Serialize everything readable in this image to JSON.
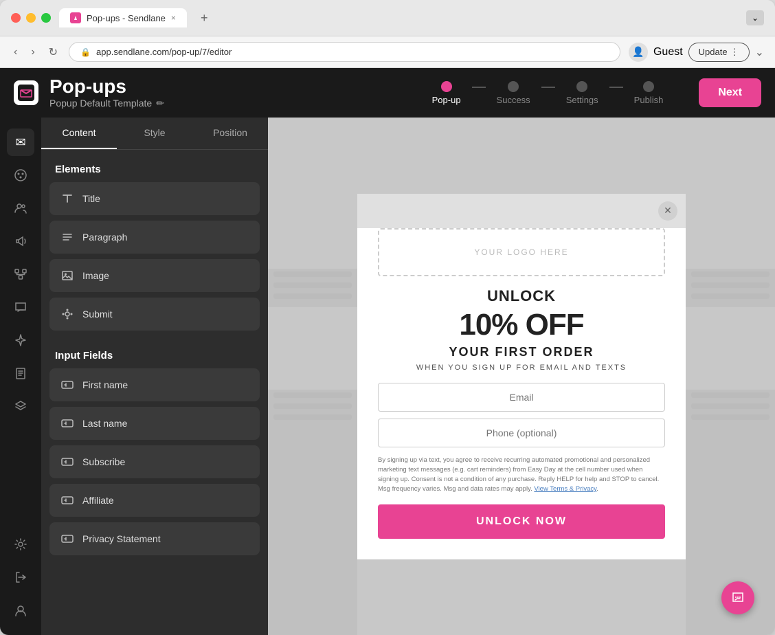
{
  "browser": {
    "tab_title": "Pop-ups - Sendlane",
    "tab_close": "×",
    "new_tab": "+",
    "address": "app.sendlane.com/pop-up/7/editor",
    "account_label": "Guest",
    "update_label": "Update",
    "expand_label": "⌄"
  },
  "header": {
    "title": "Pop-ups",
    "subtitle": "Popup Default Template",
    "edit_icon": "✏",
    "next_label": "Next"
  },
  "wizard": {
    "steps": [
      {
        "label": "Pop-up",
        "active": true
      },
      {
        "label": "Success",
        "active": false
      },
      {
        "label": "Settings",
        "active": false
      },
      {
        "label": "Publish",
        "active": false
      }
    ]
  },
  "sidebar_tabs": [
    "Content",
    "Style",
    "Position"
  ],
  "active_sidebar_tab": "Content",
  "elements_section": "Elements",
  "elements": [
    {
      "icon": "T",
      "label": "Title"
    },
    {
      "icon": "≡",
      "label": "Paragraph"
    },
    {
      "icon": "🖼",
      "label": "Image"
    },
    {
      "icon": "✦",
      "label": "Submit"
    }
  ],
  "input_fields_section": "Input Fields",
  "input_fields": [
    {
      "icon": "⊞",
      "label": "First name"
    },
    {
      "icon": "⊞",
      "label": "Last name"
    },
    {
      "icon": "⊞",
      "label": "Subscribe"
    },
    {
      "icon": "⊞",
      "label": "Affiliate"
    },
    {
      "icon": "⊞",
      "label": "Privacy Statement"
    }
  ],
  "nav_icons": [
    {
      "name": "mail-icon",
      "symbol": "✉",
      "active": true
    },
    {
      "name": "palette-icon",
      "symbol": "🎨",
      "active": false
    },
    {
      "name": "contacts-icon",
      "symbol": "👥",
      "active": false
    },
    {
      "name": "megaphone-icon",
      "symbol": "📣",
      "active": false
    },
    {
      "name": "workflow-icon",
      "symbol": "⚙",
      "active": false
    },
    {
      "name": "chat-icon",
      "symbol": "💬",
      "active": false
    },
    {
      "name": "sparkle-icon",
      "symbol": "✨",
      "active": false
    },
    {
      "name": "pages-icon",
      "symbol": "📄",
      "active": false
    },
    {
      "name": "layers-icon",
      "symbol": "⬛",
      "active": false
    },
    {
      "name": "settings-icon",
      "symbol": "⚙",
      "active": false
    },
    {
      "name": "logout-icon",
      "symbol": "↪",
      "active": false
    },
    {
      "name": "profile-icon",
      "symbol": "👤",
      "active": false
    }
  ],
  "popup": {
    "logo_placeholder": "Your Logo Here",
    "headline1": "UNLOCK",
    "headline2": "10% OFF",
    "headline3": "YOUR FIRST ORDER",
    "subtext": "WHEN YOU SIGN UP FOR EMAIL AND TEXTS",
    "email_placeholder": "Email",
    "phone_placeholder": "Phone (optional)",
    "legal_text": "By signing up via text, you agree to receive recurring automated promotional and personalized marketing text messages (e.g. cart reminders) from Easy Day at the cell number used when signing up. Consent is not a condition of any purchase. Reply HELP for help and STOP to cancel. Msg frequency varies. Msg and data rates may apply.",
    "legal_link_text": "View Terms & Privacy",
    "cta_label": "UNLOCK NOW"
  },
  "colors": {
    "accent": "#e84393",
    "sidebar_bg": "#2d2d2d",
    "header_bg": "#1a1a1a",
    "active_dot": "#e84393",
    "inactive_dot": "#666666"
  }
}
